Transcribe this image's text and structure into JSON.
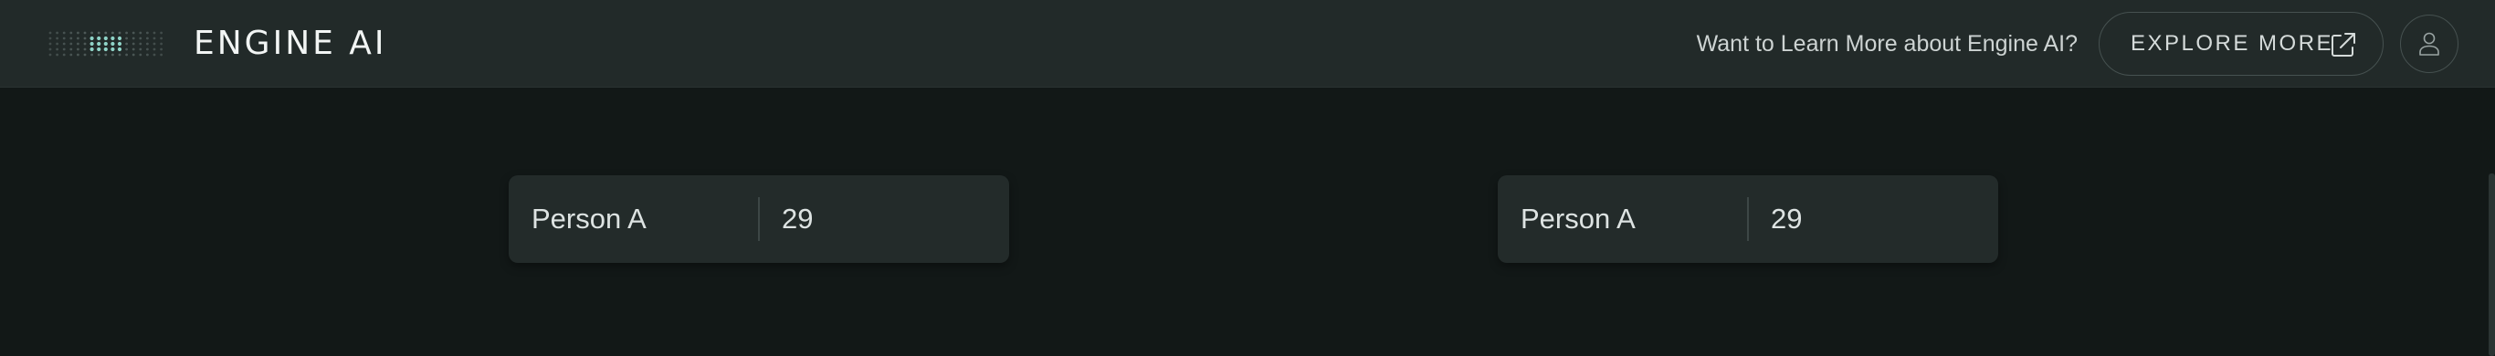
{
  "header": {
    "brand": "ENGINE AI",
    "learn_more_text": "Want to Learn More about Engine AI?",
    "explore_label": "EXPLORE MORE",
    "explore_icon": "external-link-icon",
    "avatar_icon": "user-icon"
  },
  "cards": [
    {
      "name": "Person A",
      "age": "29"
    },
    {
      "name": "Person A",
      "age": "29"
    }
  ],
  "colors": {
    "background": "#121817",
    "header": "#222a29",
    "card": "#232b2a",
    "logo_accent": "#8fd3c7"
  }
}
